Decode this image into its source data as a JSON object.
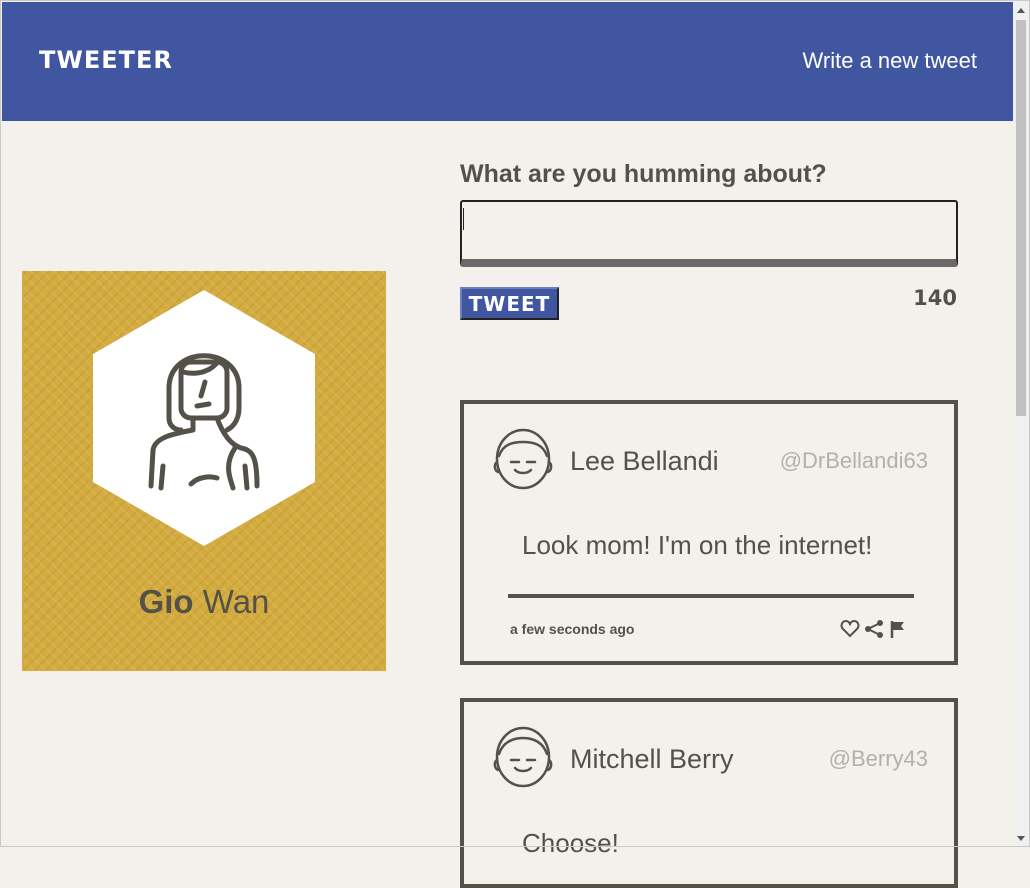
{
  "nav": {
    "brand": "TWEETER",
    "compose_link": "Write a new tweet"
  },
  "profile": {
    "first_name": "Gio",
    "last_name": "Wan",
    "background_color": "#d4ab3e"
  },
  "compose": {
    "heading": "What are you humming about?",
    "input_value": "",
    "button_label": "TWEET",
    "counter": "140"
  },
  "tweets": [
    {
      "name": "Lee Bellandi",
      "handle": "@DrBellandi63",
      "text": "Look mom! I'm on the internet!",
      "time": "a few seconds ago",
      "actions": [
        "heart-icon",
        "share-icon",
        "flag-icon"
      ]
    },
    {
      "name": "Mitchell Berry",
      "handle": "@Berry43",
      "text": "Choose!"
    }
  ],
  "colors": {
    "nav_background": "#4056a1",
    "page_background": "#f4f1ec",
    "text": "#545149",
    "handle": "#b3b0a8"
  }
}
